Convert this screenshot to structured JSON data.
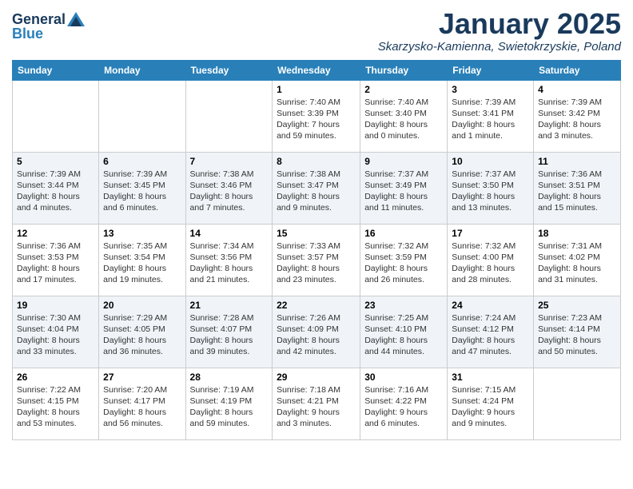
{
  "header": {
    "logo_general": "General",
    "logo_blue": "Blue",
    "title": "January 2025",
    "subtitle": "Skarzysko-Kamienna, Swietokrzyskie, Poland"
  },
  "columns": [
    "Sunday",
    "Monday",
    "Tuesday",
    "Wednesday",
    "Thursday",
    "Friday",
    "Saturday"
  ],
  "weeks": [
    [
      {
        "day": "",
        "info": ""
      },
      {
        "day": "",
        "info": ""
      },
      {
        "day": "",
        "info": ""
      },
      {
        "day": "1",
        "info": "Sunrise: 7:40 AM\nSunset: 3:39 PM\nDaylight: 7 hours and 59 minutes."
      },
      {
        "day": "2",
        "info": "Sunrise: 7:40 AM\nSunset: 3:40 PM\nDaylight: 8 hours and 0 minutes."
      },
      {
        "day": "3",
        "info": "Sunrise: 7:39 AM\nSunset: 3:41 PM\nDaylight: 8 hours and 1 minute."
      },
      {
        "day": "4",
        "info": "Sunrise: 7:39 AM\nSunset: 3:42 PM\nDaylight: 8 hours and 3 minutes."
      }
    ],
    [
      {
        "day": "5",
        "info": "Sunrise: 7:39 AM\nSunset: 3:44 PM\nDaylight: 8 hours and 4 minutes."
      },
      {
        "day": "6",
        "info": "Sunrise: 7:39 AM\nSunset: 3:45 PM\nDaylight: 8 hours and 6 minutes."
      },
      {
        "day": "7",
        "info": "Sunrise: 7:38 AM\nSunset: 3:46 PM\nDaylight: 8 hours and 7 minutes."
      },
      {
        "day": "8",
        "info": "Sunrise: 7:38 AM\nSunset: 3:47 PM\nDaylight: 8 hours and 9 minutes."
      },
      {
        "day": "9",
        "info": "Sunrise: 7:37 AM\nSunset: 3:49 PM\nDaylight: 8 hours and 11 minutes."
      },
      {
        "day": "10",
        "info": "Sunrise: 7:37 AM\nSunset: 3:50 PM\nDaylight: 8 hours and 13 minutes."
      },
      {
        "day": "11",
        "info": "Sunrise: 7:36 AM\nSunset: 3:51 PM\nDaylight: 8 hours and 15 minutes."
      }
    ],
    [
      {
        "day": "12",
        "info": "Sunrise: 7:36 AM\nSunset: 3:53 PM\nDaylight: 8 hours and 17 minutes."
      },
      {
        "day": "13",
        "info": "Sunrise: 7:35 AM\nSunset: 3:54 PM\nDaylight: 8 hours and 19 minutes."
      },
      {
        "day": "14",
        "info": "Sunrise: 7:34 AM\nSunset: 3:56 PM\nDaylight: 8 hours and 21 minutes."
      },
      {
        "day": "15",
        "info": "Sunrise: 7:33 AM\nSunset: 3:57 PM\nDaylight: 8 hours and 23 minutes."
      },
      {
        "day": "16",
        "info": "Sunrise: 7:32 AM\nSunset: 3:59 PM\nDaylight: 8 hours and 26 minutes."
      },
      {
        "day": "17",
        "info": "Sunrise: 7:32 AM\nSunset: 4:00 PM\nDaylight: 8 hours and 28 minutes."
      },
      {
        "day": "18",
        "info": "Sunrise: 7:31 AM\nSunset: 4:02 PM\nDaylight: 8 hours and 31 minutes."
      }
    ],
    [
      {
        "day": "19",
        "info": "Sunrise: 7:30 AM\nSunset: 4:04 PM\nDaylight: 8 hours and 33 minutes."
      },
      {
        "day": "20",
        "info": "Sunrise: 7:29 AM\nSunset: 4:05 PM\nDaylight: 8 hours and 36 minutes."
      },
      {
        "day": "21",
        "info": "Sunrise: 7:28 AM\nSunset: 4:07 PM\nDaylight: 8 hours and 39 minutes."
      },
      {
        "day": "22",
        "info": "Sunrise: 7:26 AM\nSunset: 4:09 PM\nDaylight: 8 hours and 42 minutes."
      },
      {
        "day": "23",
        "info": "Sunrise: 7:25 AM\nSunset: 4:10 PM\nDaylight: 8 hours and 44 minutes."
      },
      {
        "day": "24",
        "info": "Sunrise: 7:24 AM\nSunset: 4:12 PM\nDaylight: 8 hours and 47 minutes."
      },
      {
        "day": "25",
        "info": "Sunrise: 7:23 AM\nSunset: 4:14 PM\nDaylight: 8 hours and 50 minutes."
      }
    ],
    [
      {
        "day": "26",
        "info": "Sunrise: 7:22 AM\nSunset: 4:15 PM\nDaylight: 8 hours and 53 minutes."
      },
      {
        "day": "27",
        "info": "Sunrise: 7:20 AM\nSunset: 4:17 PM\nDaylight: 8 hours and 56 minutes."
      },
      {
        "day": "28",
        "info": "Sunrise: 7:19 AM\nSunset: 4:19 PM\nDaylight: 8 hours and 59 minutes."
      },
      {
        "day": "29",
        "info": "Sunrise: 7:18 AM\nSunset: 4:21 PM\nDaylight: 9 hours and 3 minutes."
      },
      {
        "day": "30",
        "info": "Sunrise: 7:16 AM\nSunset: 4:22 PM\nDaylight: 9 hours and 6 minutes."
      },
      {
        "day": "31",
        "info": "Sunrise: 7:15 AM\nSunset: 4:24 PM\nDaylight: 9 hours and 9 minutes."
      },
      {
        "day": "",
        "info": ""
      }
    ]
  ]
}
